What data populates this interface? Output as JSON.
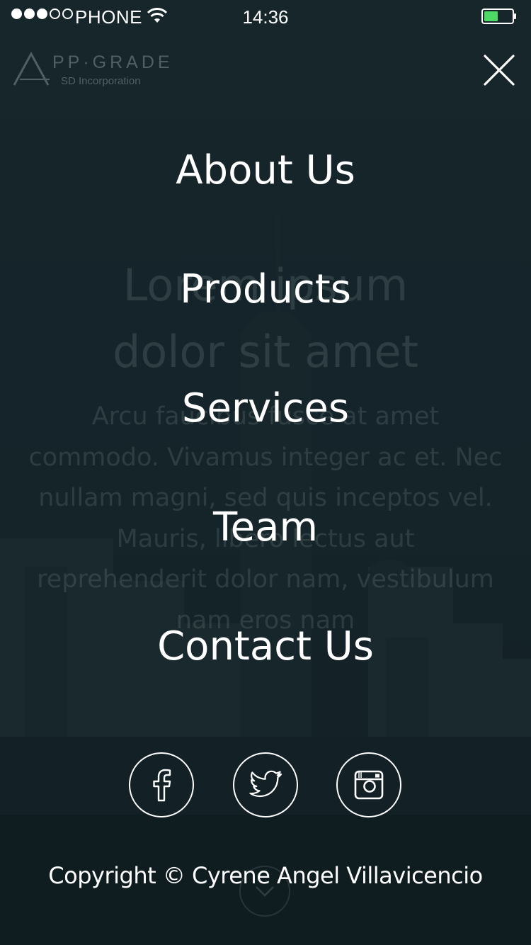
{
  "status_bar": {
    "carrier": "PHONE",
    "time": "14:36",
    "signal_filled": 3,
    "signal_total": 5,
    "battery_level": 0.5,
    "battery_color": "#4cd964",
    "icons": [
      "signal-dots-icon",
      "wifi-icon",
      "battery-icon"
    ]
  },
  "background": {
    "logo_main": "PP·GRADE",
    "logo_sub": "SD Incorporation",
    "hero_title": "Lorem ipsum\ndolor sit amet",
    "hero_text": "Arcu faucibus fusce at amet commodo. Vivamus integer ac et. Nec nullam magni, sed quis inceptos vel. Mauris, libero lectus aut reprehenderit dolor nam, vestibulum nam eros nam"
  },
  "menu": {
    "close_icon": "close-icon",
    "items": [
      {
        "label": "About Us"
      },
      {
        "label": "Products"
      },
      {
        "label": "Services"
      },
      {
        "label": "Team"
      },
      {
        "label": "Contact Us"
      }
    ]
  },
  "social": [
    {
      "icon": "facebook-icon"
    },
    {
      "icon": "twitter-icon"
    },
    {
      "icon": "instagram-icon"
    }
  ],
  "footer": {
    "copyright": "Copyright © Cyrene Angel Villavicencio",
    "scroll_icon": "chevron-down-icon"
  },
  "colors": {
    "overlay": "#16272c",
    "text": "#ffffff"
  }
}
